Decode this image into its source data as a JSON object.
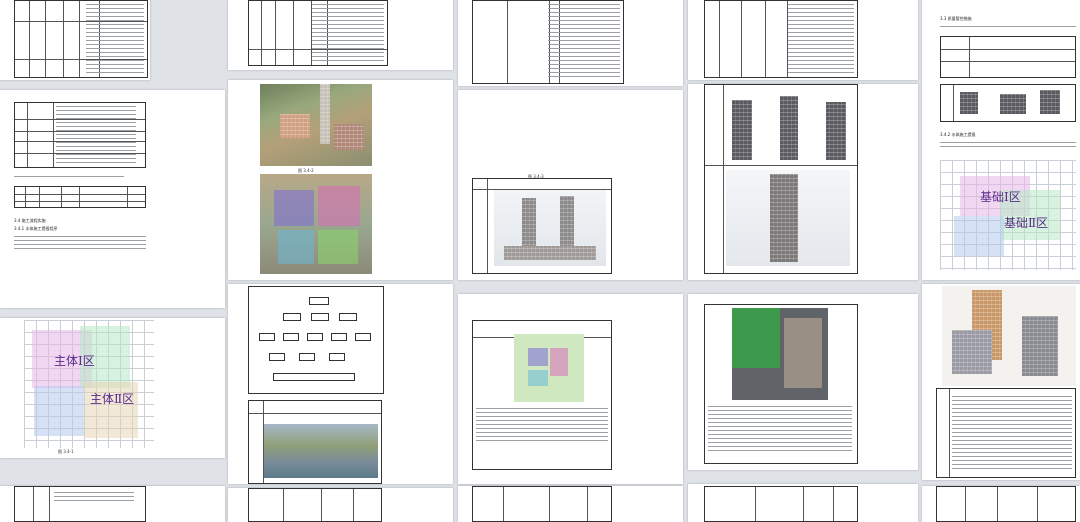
{
  "headings": {
    "h_341": "3.4.1  水体施工提报程序",
    "h_340": "3.4  施工流程实施",
    "h_342": "3.4.2  水体施工提报",
    "h_332": "3.3  质量管控措施"
  },
  "zone_labels": {
    "z1": "主体Ⅰ区",
    "z2": "主体Ⅱ区",
    "z3": "基础Ⅰ区",
    "z4": "基础Ⅱ区"
  },
  "icons": [
    "aerial-photo-icon",
    "building-render-icon",
    "bim-model-icon",
    "org-chart-icon",
    "grid-plan-icon"
  ]
}
